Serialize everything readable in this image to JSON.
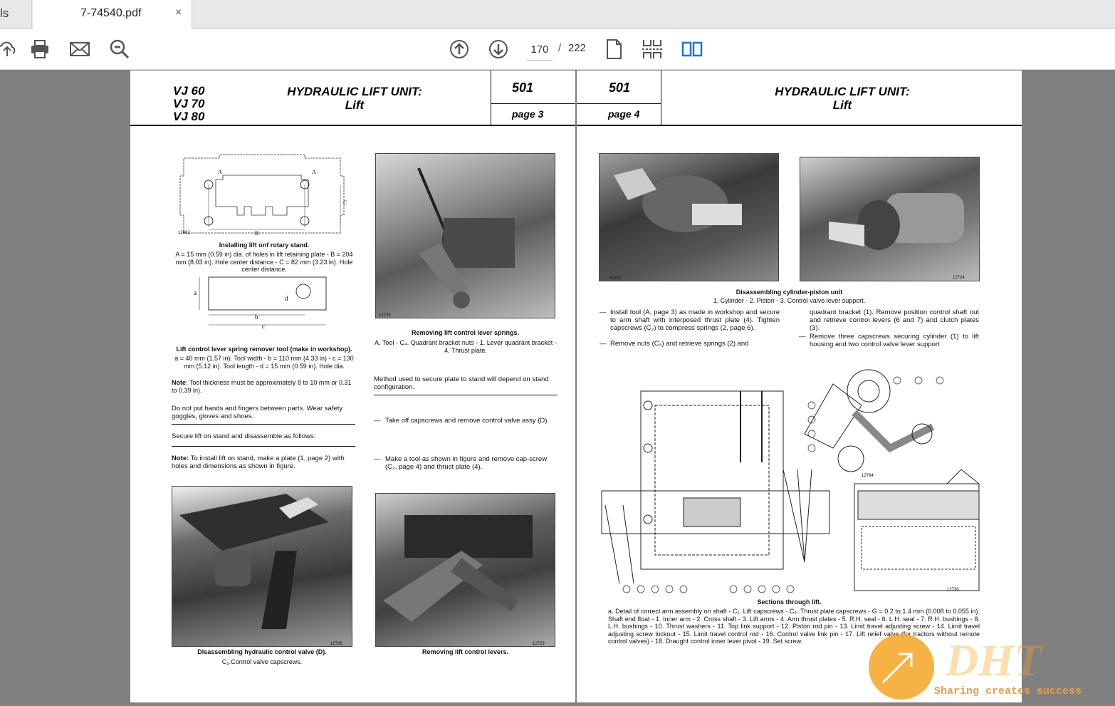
{
  "tabs": {
    "previous_tab_fragment": "ls",
    "active_tab_title": "7-74540.pdf",
    "close_glyph": "×"
  },
  "toolbar": {
    "current_page": "170",
    "separator": "/",
    "total_pages": "222"
  },
  "left_page": {
    "models": [
      "VJ 60",
      "VJ 70",
      "VJ 80"
    ],
    "title_line1": "HYDRAULIC LIFT UNIT:",
    "title_line2": "Lift",
    "section": "501",
    "page_label": "page 3",
    "fig1_caption_bold": "Installing lift onf rotary stand.",
    "fig1_caption": "A = 15 mm (0.59 in) dia. of holes in lift retaining plate - B = 204 mm (8.03 in). Hole center distance - C = 82 mm (3.23 in). Hole center distance.",
    "fig2_caption_bold": "Lift control lever spring remover tool (make in workshop).",
    "fig2_caption": "a = 40 mm (1.57 in). Tool width - b = 110 mm (4.33 in) - c = 130 mm (5.12 in). Tool length - d = 15 mm (0.59 in). Hole dia.",
    "note_thickness_bold": "Note",
    "note_thickness": ": Tool thickness must be approximately 8 to 10 mm or 0.31 to 0.39 in).",
    "warning": "Do not put hands and fingers between parts. Wear safety goggles, gloves and shoes.",
    "secure": "Secure lift on stand and disassemble as follows:",
    "note2_bold": "Note:",
    "note2": " To install lift on stand, make a plate (1, page 2) with holes and dimensions as shown in figure.",
    "photo1_caption_bold": "Removing lift control lever springs.",
    "photo1_caption": "A. Tool - C₄. Quadrant bracket nuts - 1. Lever quadrant bracket - 4. Thrust plate.",
    "method": "Method used to secure plate to stand will depend on stand configuration.",
    "step1": "Take off capscrews and remove control valve assy (D).",
    "step2": "Make a tool as shown in figure and remove cap-screw (C₂, page 4) and thrust plate (4).",
    "photo3_caption_bold": "Disassembling hydraulic control valve (D).",
    "photo3_caption": "C₂.Control valve capscrews.",
    "photo4_caption_bold": "Removing lift control levers.",
    "fig_ids": [
      "12662",
      "12725",
      "12726",
      "12723"
    ]
  },
  "right_page": {
    "section": "501",
    "page_label": "page 4",
    "title_line1": "HYDRAULIC LIFT UNIT:",
    "title_line2": "Lift",
    "photos_caption_bold": "Disassembling cylinder-piston unit",
    "photos_caption": "1. Cylinder - 2. Piston - 3. Control valve lever support.",
    "bullet1": "Install tool (A, page 3) as made in workshop and secure to arm shaft with interposed thrust plate (4). Tighten capscrews (C₂) to compress springs (2, page 6).",
    "bullet2": "Remove nuts (C₄) and retrieve springs (2) and",
    "col2_text": "quadrant bracket (1). Remove position control shaft nut and retrieve control levers (6 and 7) and clutch plates (3).",
    "bullet3": "Remove three capscrews securing cylinder (1) to lift housing and two control valve lever support",
    "sections_caption_bold": "Sections through lift.",
    "sections_caption": "a. Detail of correct arm assembly on shaft - C₁. Lift capscrews - C₂. Thrust plate capscrews - G = 0.2 to 1.4 mm (0.008 to 0.055 in). Shaft end float - 1. Inner arm - 2. Cross shaft - 3. Lift arms - 4. Arm thrust plates - 5. R.H. seal - 6. L.H. seal - 7. R.H. bushings - 8. L.H. bushings - 10. Thrust washers - 11. Top link support - 12. Piston rod pin - 13. Limit travel adjusting screw - 14. Limit travel adjusting screw locknut - 15. Limit travel control rod - 16. Control valve link pin - 17. Lift relief valve (for tractors without remote control valves) - 18. Draught control inner lever pivot - 19. Set screw.",
    "fig_ids": [
      "12727",
      "12724",
      "12764",
      "12730"
    ]
  },
  "watermark": {
    "text": "Sharing creates success"
  },
  "colors": {
    "accent": "#1a73e8",
    "watermark": "#f5a623"
  }
}
